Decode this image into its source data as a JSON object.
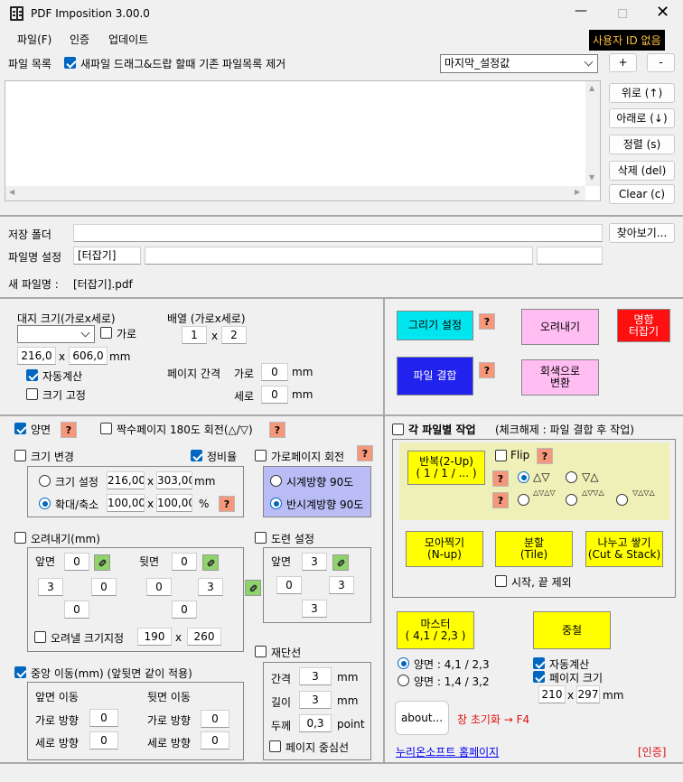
{
  "window": {
    "title": "PDF Imposition 3.00.0"
  },
  "menu": {
    "file": "파일(F)",
    "auth": "인증",
    "update": "업데이트",
    "user_id": "사용자 ID 없음"
  },
  "filelist": {
    "label": "파일 목록",
    "remove_on_drop": "새파일 드래그&드랍 할때 기존 파일목록 제거",
    "preset": "마지막_설정값",
    "plus": "+",
    "minus": "-",
    "up": "위로 (↑)",
    "down": "아래로 (↓)",
    "sort": "정렬 (s)",
    "del": "삭제 (del)",
    "clear": "Clear (c)"
  },
  "save": {
    "folder_label": "저장 폴더",
    "browse": "찾아보기...",
    "name_label": "파일명 설정",
    "name_value": "[터잡기]",
    "new_label": "새 파일명 :",
    "new_value": "[터잡기].pdf"
  },
  "paper": {
    "label": "대지 크기(가로x세로)",
    "landscape": "가로",
    "w": "216,0",
    "x": "x",
    "h": "606,0",
    "unit": "mm",
    "auto": "자동계산",
    "fixed": "크기 고정"
  },
  "arrange": {
    "label": "배열 (가로x세로)",
    "cols": "1",
    "x": "x",
    "rows": "2",
    "gap_label": "페이지 간격",
    "gap_h_label": "가로",
    "gap_h": "0",
    "gap_v_label": "세로",
    "gap_v": "0",
    "mm": "mm"
  },
  "actions": {
    "draw": "그리기 설정",
    "q": "?",
    "trim": "오려내기",
    "name1": "명함",
    "name2": "터잡기",
    "merge": "파일 결합",
    "gray1": "회색으로",
    "gray2": "변환"
  },
  "duplex": {
    "label": "양면",
    "q": "?",
    "even_rotate": "짝수페이지 180도 회전(△/▽)"
  },
  "resize": {
    "label": "크기 변경",
    "ratio": "정비율",
    "set_size": "크기 설정",
    "w": "216,00",
    "x": "x",
    "h": "303,00",
    "mm": "mm",
    "scale": "확대/축소",
    "sw": "100,00",
    "sh": "100,00",
    "pct": "%"
  },
  "landscape_rotate": {
    "label": "가로페이지 회전",
    "cw": "시계방향 90도",
    "ccw": "반시계방향 90도"
  },
  "bleed": {
    "label": "오려내기(mm)",
    "front": "앞면",
    "back": "뒷면",
    "f_top": "0",
    "f_left": "3",
    "f_right": "0",
    "f_bottom": "0",
    "b_top": "0",
    "b_left": "0",
    "b_right": "3",
    "b_bottom": "0",
    "size_label": "오려낼 크기지정",
    "sw": "190",
    "x": "x",
    "sh": "260"
  },
  "tombo": {
    "label": "도련 설정",
    "front": "앞면",
    "top": "3",
    "left": "0",
    "right": "3",
    "bottom": "3"
  },
  "center": {
    "label": "중앙 이동(mm) (앞뒷면 같이 적용)",
    "front": "앞면 이동",
    "back": "뒷면 이동",
    "h": "가로 방향",
    "v": "세로 방향",
    "fh": "0",
    "fv": "0",
    "bh": "0",
    "bv": "0"
  },
  "cutline": {
    "label": "재단선",
    "gap": "간격",
    "gap_v": "3",
    "len": "길이",
    "len_v": "3",
    "thick": "두께",
    "thick_v": "0,3",
    "mm": "mm",
    "point": "point",
    "center": "페이지 중심선"
  },
  "perfile": {
    "label": "각 파일별 작업",
    "hint": "(체크해제 : 파일 결합 후 작업)",
    "repeat1": "반복(2-Up)",
    "repeat2": "( 1 / 1 / ... )",
    "flip": "Flip",
    "q": "?",
    "o1": "△▽",
    "o2": "▽△",
    "o3": "△▽△▽",
    "o4": "△▽▽△",
    "o5": "▽△▽△",
    "nup1": "모아찍기",
    "nup2": "(N-up)",
    "tile1": "분할",
    "tile2": "(Tile)",
    "cut1": "나누고 쌓기",
    "cut2": "(Cut & Stack)",
    "exclude": "시작, 끝 제외"
  },
  "master": {
    "m1": "마스터",
    "m2": "( 4,1 / 2,3 )",
    "overlap": "중철",
    "both1": "양면 : 4,1 / 2,3",
    "both2": "양면 : 1,4 / 3,2",
    "auto": "자동계산",
    "pagesize": "페이지 크기",
    "pw": "210",
    "x": "x",
    "ph": "297",
    "mm": "mm"
  },
  "footer": {
    "about": "about...",
    "reset": "창 초기화 → F4",
    "homepage": "누리온소프트 홈페이지",
    "auth": "[인증]"
  },
  "colors": {
    "cyan": "#00e5ee",
    "blue": "#2222ee",
    "pink": "#ffbdf2",
    "red": "#ff1010",
    "yellow": "#ffff00",
    "olive": "#efefb8",
    "lavender": "#b9bcf5",
    "qbtn": "#f4977a",
    "accent": "#0067c0"
  }
}
